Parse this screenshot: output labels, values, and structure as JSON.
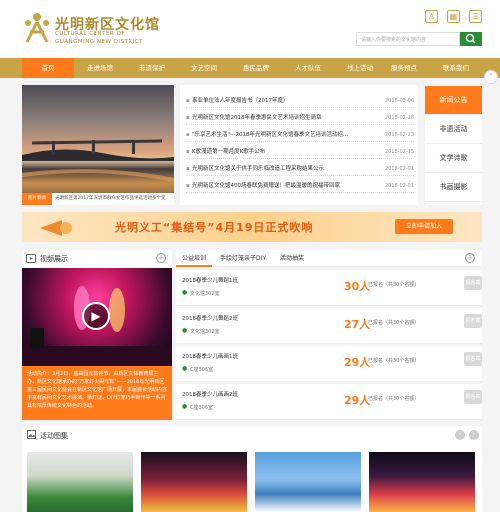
{
  "header": {
    "logo_cn": "光明新区文化馆",
    "logo_en_line1": "CULTURAL CENTER OF",
    "logo_en_line2": "GUANGMING NEW DISTRICT",
    "search_placeholder": "请输入你要搜索的文化馆内容",
    "icons": [
      "user-icon",
      "qr-code-icon",
      "menu-grid-icon"
    ]
  },
  "nav": {
    "items": [
      "首页",
      "走进场馆",
      "非遗保护",
      "文艺空间",
      "惠民品牌",
      "人才队伍",
      "线上活动",
      "服务预点",
      "联系我们"
    ],
    "active_index": 0
  },
  "slider": {
    "tag": "图片新闻",
    "caption": "光明新区第2017年深圳市群众文艺作品评选活动多个奖"
  },
  "news": {
    "items": [
      {
        "title": "事业单位法人年度报告书（2017年度）",
        "date": "2018-03-06"
      },
      {
        "title": "光明新区文化馆2018年春季惠民文艺术培训招生简章",
        "date": "2018-02-28"
      },
      {
        "title": "\"乐享艺术生活\"—2018年光明新区文化馆春季文艺培训活动招…",
        "date": "2018-02-23"
      },
      {
        "title": "K歌漫道第一期月度K歌手公布",
        "date": "2018-02-15"
      },
      {
        "title": "光明新区文化馆关于供手同乐临改造工程采购结果公示",
        "date": "2018-02-01"
      },
      {
        "title": "光明新区文化馆400场春联免费赠送！把最温暖的祝福带回家",
        "date": "2018-02-01"
      }
    ]
  },
  "side_tabs": [
    "新闻公告",
    "非遗活动",
    "文学诗歌",
    "书画摄影"
  ],
  "banner": {
    "title": "光明义工“集结号”4月19日正式吹响",
    "button": "立即申请加入"
  },
  "video": {
    "heading": "视频展示",
    "text": "活动简介：3月2日，盛曲园元宵佳节，由新区文体教育局主办，新区文化馆承办的\"万家灯火闹元宵\"——2018年光明新区第三届民间文化盛会在新区文化馆广场开展，本届盛会活动内容丰富有民间文化艺术展演、猜灯谜、DIY灯笼巧手制作等一系列具有浓厚传统文化特色的活动。"
  },
  "training": {
    "tabs": [
      "公益培训",
      "手绘灯笼亲子DIY",
      "活动抽奖"
    ],
    "active_tab": 0,
    "courses": [
      {
        "title": "2018春季少儿舞蹈1班",
        "place": "文化馆302室",
        "count": "30人",
        "note": "已报名（共30个名额）",
        "button": "报名截止"
      },
      {
        "title": "2018春季少儿舞蹈2班",
        "place": "文化馆302室",
        "count": "27人",
        "note": "已报名（共30个名额）",
        "button": "报名截止"
      },
      {
        "title": "2018春季少儿画画1班",
        "place": "C座306室",
        "count": "29人",
        "note": "已报名（共30个名额）",
        "button": "报名截止"
      },
      {
        "title": "2018春季少儿画画2班",
        "place": "C座306室",
        "count": "29人",
        "note": "已报名（共30个名额）",
        "button": "报名截止"
      }
    ]
  },
  "gallery": {
    "heading": "活动图集"
  },
  "colors": {
    "gold": "#c9a447",
    "orange": "#ff7a1a",
    "green": "#2a8b3b"
  }
}
